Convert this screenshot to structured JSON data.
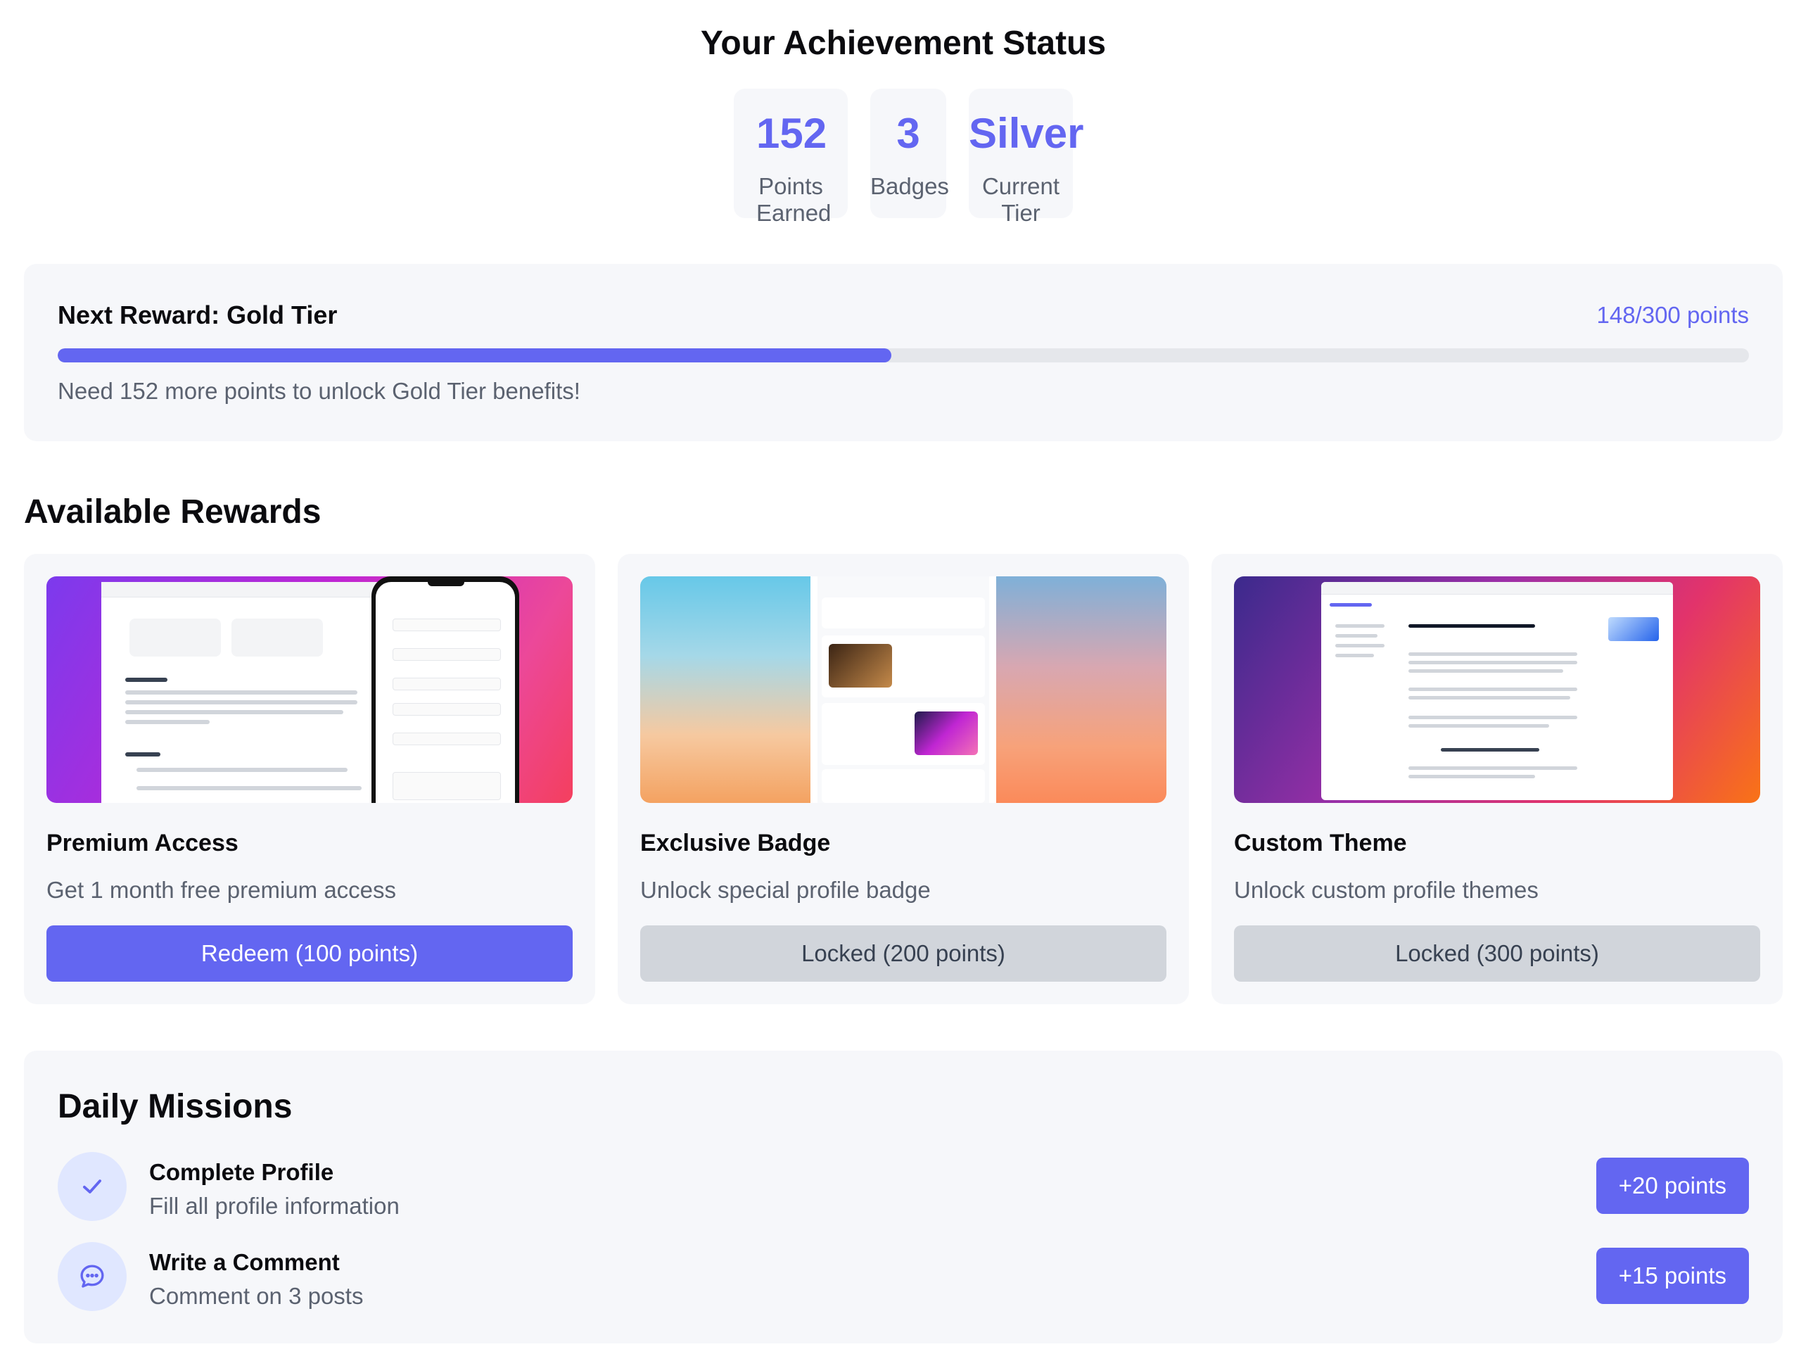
{
  "header": {
    "title": "Your Achievement Status"
  },
  "stats": [
    {
      "value": "152",
      "label": "Points Earned"
    },
    {
      "value": "3",
      "label": "Badges"
    },
    {
      "value": "Silver",
      "label": "Current Tier"
    }
  ],
  "next_reward": {
    "title": "Next Reward: Gold Tier",
    "points_text": "148/300 points",
    "progress_fraction": 0.493,
    "note": "Need 152 more points to unlock Gold Tier benefits!"
  },
  "rewards": {
    "title": "Available Rewards",
    "items": [
      {
        "title": "Premium Access",
        "description": "Get 1 month free premium access",
        "button": "Redeem (100 points)",
        "state": "available"
      },
      {
        "title": "Exclusive Badge",
        "description": "Unlock special profile badge",
        "button": "Locked (200 points)",
        "state": "locked"
      },
      {
        "title": "Custom Theme",
        "description": "Unlock custom profile themes",
        "button": "Locked (300 points)",
        "state": "locked"
      }
    ]
  },
  "missions": {
    "title": "Daily Missions",
    "items": [
      {
        "icon": "check-icon",
        "title": "Complete Profile",
        "description": "Fill all profile information",
        "button": "+20 points"
      },
      {
        "icon": "chat-bubble-icon",
        "title": "Write a Comment",
        "description": "Comment on 3 posts",
        "button": "+15 points"
      }
    ]
  },
  "colors": {
    "accent": "#6366f1",
    "card_bg": "#f6f7fa",
    "locked": "#d1d5db"
  }
}
